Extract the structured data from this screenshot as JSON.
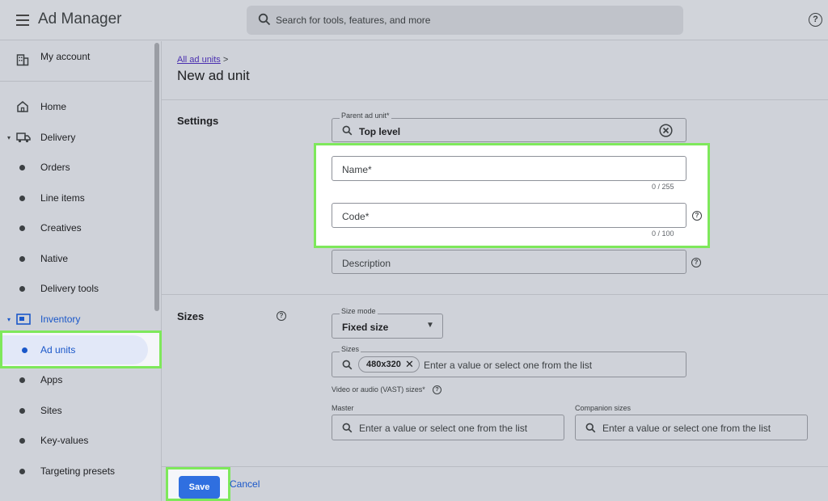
{
  "app": {
    "title": "Ad Manager"
  },
  "search": {
    "placeholder": "Search for tools, features, and more"
  },
  "sidebar": {
    "account_label": "My account",
    "items": [
      {
        "label": "Home"
      },
      {
        "label": "Delivery"
      },
      {
        "label": "Orders"
      },
      {
        "label": "Line items"
      },
      {
        "label": "Creatives"
      },
      {
        "label": "Native"
      },
      {
        "label": "Delivery tools"
      },
      {
        "label": "Inventory"
      },
      {
        "label": "Ad units"
      },
      {
        "label": "Apps"
      },
      {
        "label": "Sites"
      },
      {
        "label": "Key-values"
      },
      {
        "label": "Targeting presets"
      }
    ],
    "active_item": "Ad units"
  },
  "breadcrumb": {
    "link": "All ad units",
    "separator": ">"
  },
  "page": {
    "title": "New ad unit"
  },
  "settings": {
    "section_title": "Settings",
    "parent_label": "Parent ad unit*",
    "parent_value": "Top level",
    "name_placeholder": "Name*",
    "name_counter": "0 / 255",
    "code_placeholder": "Code*",
    "code_counter": "0 / 100",
    "description_placeholder": "Description"
  },
  "sizes": {
    "section_title": "Sizes",
    "size_mode_label": "Size mode",
    "size_mode_value": "Fixed size",
    "sizes_label": "Sizes",
    "chip": "480x320",
    "sizes_placeholder": "Enter a value or select one from the list",
    "vast_label": "Video or audio (VAST) sizes*",
    "master_label": "Master",
    "master_placeholder": "Enter a value or select one from the list",
    "companion_label": "Companion sizes",
    "companion_placeholder": "Enter a value or select one from the list"
  },
  "actions": {
    "save": "Save",
    "cancel": "Cancel"
  },
  "colors": {
    "accent": "#2f6fe0",
    "highlight": "#7ee85b",
    "link": "#4a2fb0"
  }
}
